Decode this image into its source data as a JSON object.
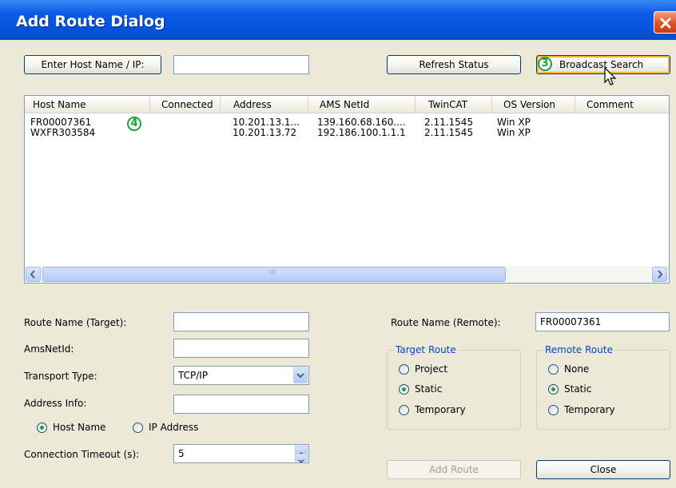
{
  "window": {
    "title": "Add Route Dialog"
  },
  "top": {
    "enter_host_label": "Enter Host Name / IP:",
    "host_input_value": "",
    "refresh_label": "Refresh Status",
    "broadcast_label": "Broadcast Search",
    "badge_3": "3",
    "badge_4": "4"
  },
  "list": {
    "columns": [
      "Host Name",
      "Connected",
      "Address",
      "AMS NetId",
      "TwinCAT",
      "OS Version",
      "Comment"
    ],
    "rows": [
      {
        "host": "FR00007361",
        "connected": "",
        "address": "10.201.13.1...",
        "ams": "139.160.68.160....",
        "twincat": "2.11.1545",
        "os": "Win XP",
        "comment": ""
      },
      {
        "host": "WXFR303584",
        "connected": "",
        "address": "10.201.13.72",
        "ams": "192.186.100.1.1.1",
        "twincat": "2.11.1545",
        "os": "Win XP",
        "comment": ""
      }
    ],
    "scroll_grip": "III"
  },
  "form": {
    "route_name_target_label": "Route Name (Target):",
    "route_name_target_value": "",
    "amsnetid_label": "AmsNetId:",
    "amsnetid_value": "",
    "transport_label": "Transport Type:",
    "transport_value": "TCP/IP",
    "address_info_label": "Address Info:",
    "address_info_value": "",
    "host_name_radio": "Host Name",
    "ip_address_radio": "IP Address",
    "timeout_label": "Connection Timeout (s):",
    "timeout_value": "5",
    "route_name_remote_label": "Route Name (Remote):",
    "route_name_remote_value": "FR00007361"
  },
  "target_route": {
    "legend": "Target Route",
    "options": [
      "Project",
      "Static",
      "Temporary"
    ],
    "selected": "Static"
  },
  "remote_route": {
    "legend": "Remote Route",
    "options": [
      "None",
      "Static",
      "Temporary"
    ],
    "selected": "Static"
  },
  "buttons": {
    "add_route": "Add Route",
    "close": "Close"
  },
  "colors": {
    "title_bar": "#0454de",
    "badge_green": "#1aa33b",
    "legend_blue": "#0046d5"
  }
}
